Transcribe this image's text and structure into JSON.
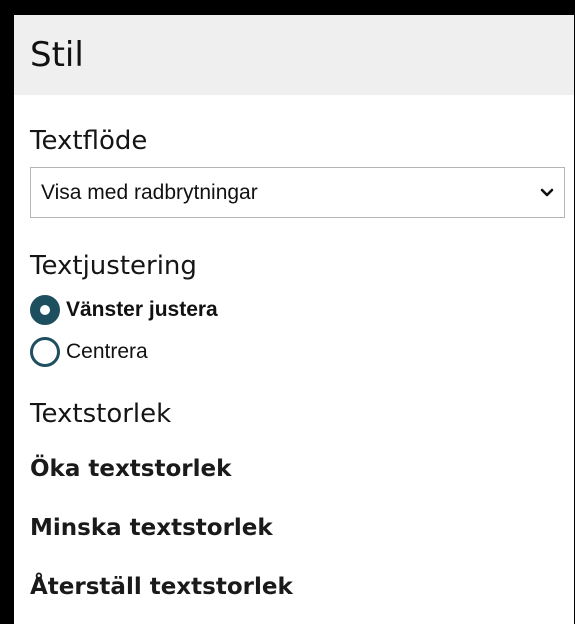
{
  "header": {
    "title": "Stil"
  },
  "text_flow": {
    "heading": "Textflöde",
    "select_value": "Visa med radbrytningar",
    "chevron_icon": "chevron-down-icon"
  },
  "text_alignment": {
    "heading": "Textjustering",
    "options": [
      {
        "label": "Vänster justera",
        "checked": true
      },
      {
        "label": "Centrera",
        "checked": false
      }
    ],
    "accent_color": "#1d4f5e"
  },
  "text_size": {
    "heading": "Textstorlek",
    "links": [
      "Öka textstorlek",
      "Minska textstorlek",
      "Återställ textstorlek"
    ]
  }
}
